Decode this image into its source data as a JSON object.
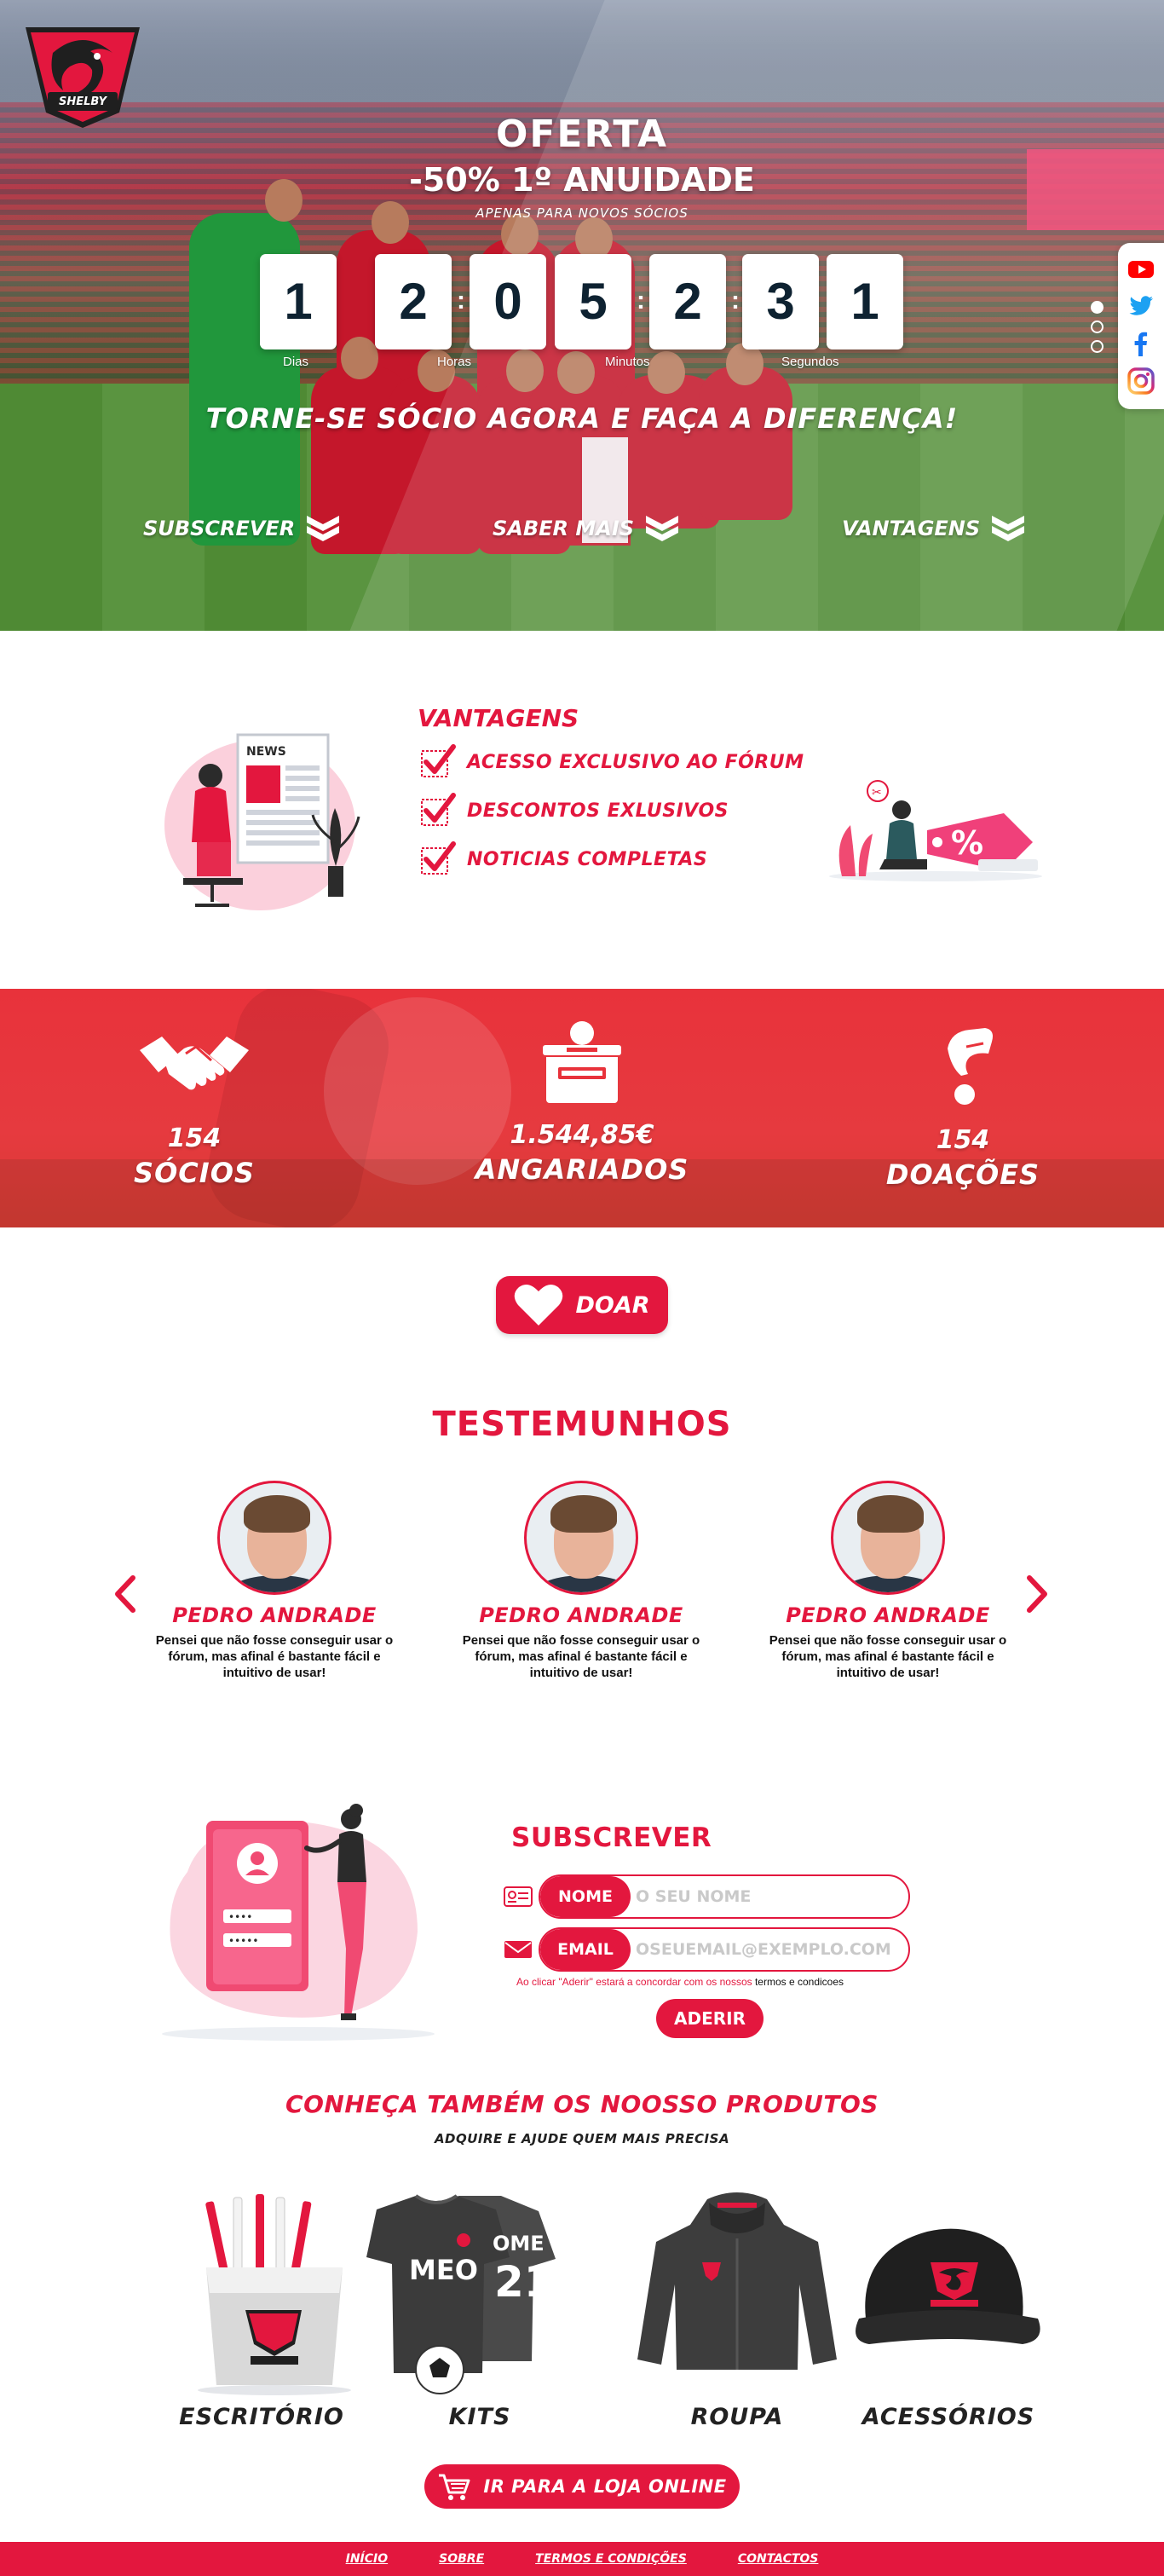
{
  "brand": {
    "logo_text": "SHELBY",
    "accent": "#e3173e"
  },
  "hero": {
    "offer_title": "OFERTA",
    "offer_subtitle": "-50% 1º ANUIDADE",
    "offer_note": "APENAS PARA NOVOS SÓCIOS",
    "countdown": {
      "digits": [
        "1",
        "2",
        "0",
        "5",
        "2",
        "3",
        "1"
      ],
      "labels": {
        "days": "Dias",
        "hours": "Horas",
        "minutes": "Minutos",
        "seconds": "Segundos"
      }
    },
    "tagline": "TORNE-SE SÓCIO AGORA E FAÇA A DIFERENÇA!",
    "links": [
      {
        "label": "SUBSCREVER",
        "icon": "double-chevron-down-icon"
      },
      {
        "label": "SABER MAIS",
        "icon": "double-chevron-down-icon"
      },
      {
        "label": "VANTAGENS",
        "icon": "double-chevron-down-icon"
      }
    ],
    "social": [
      {
        "name": "youtube-icon",
        "color": "#ff0000"
      },
      {
        "name": "twitter-icon",
        "color": "#1da1f2"
      },
      {
        "name": "facebook-icon",
        "color": "#1877f2"
      },
      {
        "name": "instagram-icon",
        "color": "#d62976"
      }
    ]
  },
  "advantages": {
    "title": "VANTAGENS",
    "items": [
      "ACESSO EXCLUSIVO AO FÓRUM",
      "DESCONTOS EXLUSIVOS",
      "NOTICIAS COMPLETAS"
    ],
    "illustration_left_text": "NEWS"
  },
  "stats": [
    {
      "value": "154",
      "label": "SÓCIOS",
      "icon": "handshake-icon"
    },
    {
      "value": "1.544,85€",
      "label": "ANGARIADOS",
      "icon": "donation-box-icon"
    },
    {
      "value": "154",
      "label": "DOAÇÕES",
      "icon": "donation-hand-icon"
    }
  ],
  "donate_button": {
    "label": "DOAR",
    "icon": "heart-icon"
  },
  "testimonials": {
    "title": "TESTEMUNHOS",
    "items": [
      {
        "name": "PEDRO ANDRADE",
        "quote": "Pensei que não fosse conseguir usar o fórum, mas afinal é bastante fácil e intuitivo de usar!"
      },
      {
        "name": "PEDRO ANDRADE",
        "quote": "Pensei que não fosse conseguir usar o fórum, mas afinal é bastante fácil e intuitivo de usar!"
      },
      {
        "name": "PEDRO ANDRADE",
        "quote": "Pensei que não fosse conseguir usar o fórum, mas afinal é bastante fácil e intuitivo de usar!"
      }
    ]
  },
  "subscribe": {
    "title": "SUBSCREVER",
    "name_tag": "NOME",
    "name_placeholder": "O SEU NOME",
    "email_tag": "EMAIL",
    "email_placeholder": "OSEUEMAIL@EXEMPLO.COM",
    "terms_text": "Ao clicar \"Aderir\" estará a concordar com os nossos ",
    "terms_link": "termos e condicoes",
    "button": "ADERIR"
  },
  "products": {
    "title": "CONHEÇA TAMBÉM OS NOOSSO PRODUTOS",
    "subtitle": "ADQUIRE E AJUDE QUEM MAIS PRECISA",
    "items": [
      {
        "label": "ESCRITÓRIO"
      },
      {
        "label": "KITS",
        "shirt_text": "MEO",
        "back_text": "OME",
        "back_number": "21"
      },
      {
        "label": "ROUPA"
      },
      {
        "label": "ACESSÓRIOS"
      }
    ],
    "shop_button": "IR PARA A LOJA ONLINE"
  },
  "footer": {
    "links": [
      "INÍCIO",
      "SOBRE",
      "TERMOS E CONDIÇÕES",
      "CONTACTOS"
    ]
  }
}
